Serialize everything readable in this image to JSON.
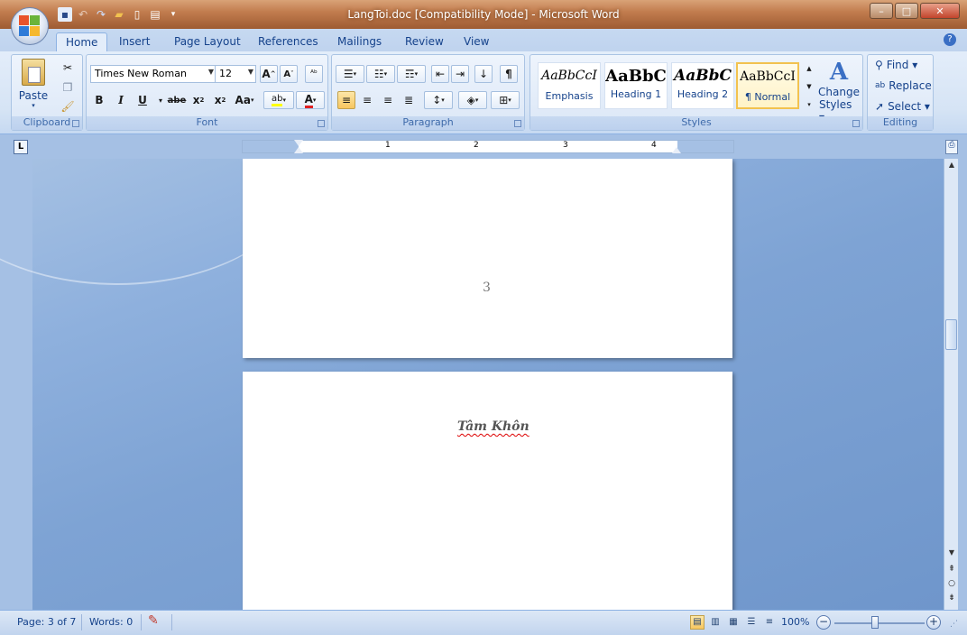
{
  "window": {
    "title": "LangToi.doc [Compatibility Mode] - Microsoft Word",
    "minimize": "–",
    "maximize": "□",
    "close": "✕"
  },
  "qat": {
    "icons": [
      "save-icon",
      "undo-icon",
      "redo-icon",
      "open-icon",
      "new-icon",
      "print-preview-icon",
      "customize-icon"
    ]
  },
  "tabs": [
    "Home",
    "Insert",
    "Page Layout",
    "References",
    "Mailings",
    "Review",
    "View"
  ],
  "active_tab": "Home",
  "clipboard": {
    "label": "Clipboard",
    "paste": "Paste"
  },
  "font": {
    "label": "Font",
    "family": "Times New Roman",
    "size": "12"
  },
  "paragraph": {
    "label": "Paragraph"
  },
  "styles": {
    "label": "Styles",
    "items": [
      {
        "sample": "AaBbCcI",
        "name": "Emphasis"
      },
      {
        "sample": "AaBbC",
        "name": "Heading 1"
      },
      {
        "sample": "AaBbC",
        "name": "Heading 2"
      },
      {
        "sample": "AaBbCcI",
        "name": "¶ Normal"
      }
    ],
    "change_styles_line1": "Change",
    "change_styles_line2": "Styles ▾"
  },
  "editing": {
    "label": "Editing",
    "find": "Find ▾",
    "replace": "Replace",
    "select": "Select ▾"
  },
  "ruler": {
    "numbers": [
      "1",
      "2",
      "3",
      "4"
    ]
  },
  "document": {
    "page_number": "3",
    "next_page_title": "Tâm Khôn"
  },
  "status": {
    "page": "Page: 3 of 7",
    "words": "Words: 0",
    "zoom": "100%"
  },
  "colors": {
    "accent": "#15428b",
    "title_bar": "#b06a3f",
    "highlight": "#f7c65f"
  }
}
